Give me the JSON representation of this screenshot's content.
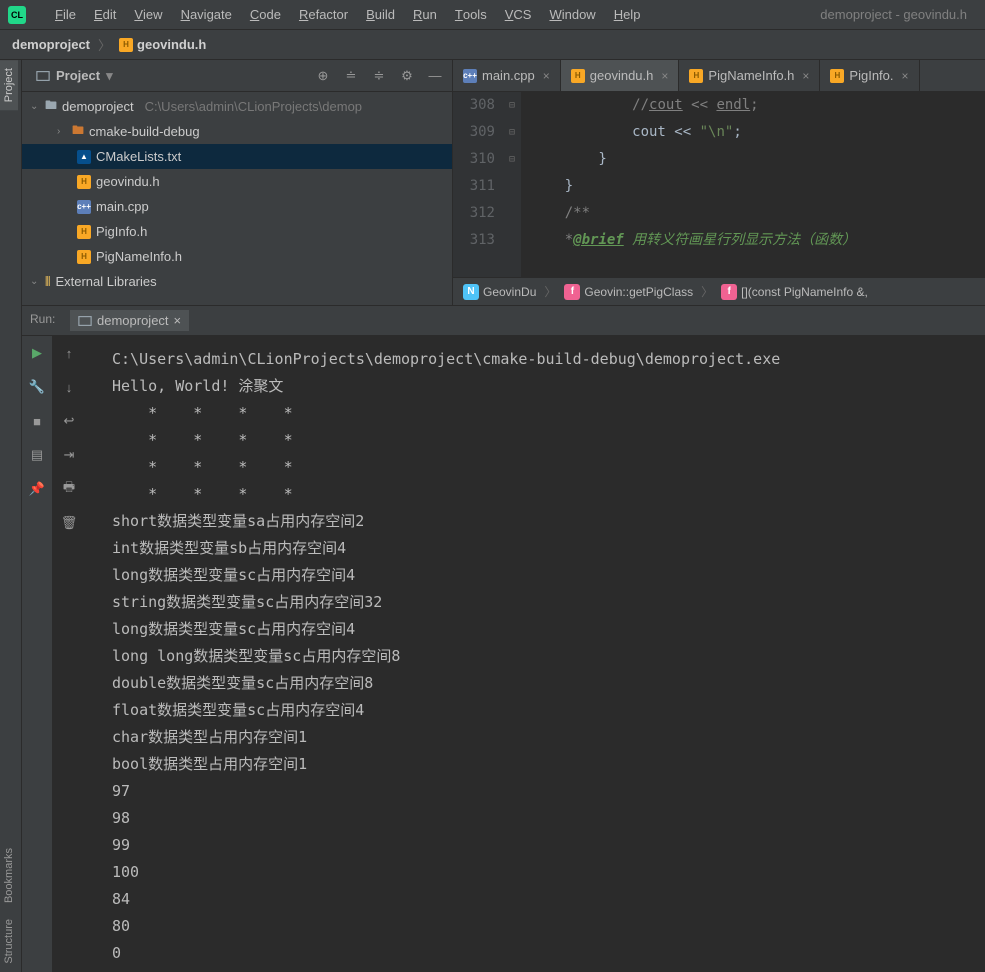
{
  "window_title": "demoproject - geovindu.h",
  "menu": [
    "File",
    "Edit",
    "View",
    "Navigate",
    "Code",
    "Refactor",
    "Build",
    "Run",
    "Tools",
    "VCS",
    "Window",
    "Help"
  ],
  "breadcrumbs": [
    {
      "label": "demoproject",
      "icon": "none"
    },
    {
      "label": "geovindu.h",
      "icon": "h"
    }
  ],
  "project_panel": {
    "title": "Project",
    "root": {
      "name": "demoproject",
      "path": "C:\\Users\\admin\\CLionProjects\\demop"
    },
    "children": [
      {
        "name": "cmake-build-debug",
        "icon": "folder-orange",
        "expandable": true
      },
      {
        "name": "CMakeLists.txt",
        "icon": "cmake"
      },
      {
        "name": "geovindu.h",
        "icon": "h"
      },
      {
        "name": "main.cpp",
        "icon": "cpp"
      },
      {
        "name": "PigInfo.h",
        "icon": "h"
      },
      {
        "name": "PigNameInfo.h",
        "icon": "h"
      }
    ],
    "external": "External Libraries"
  },
  "editor_tabs": [
    {
      "label": "main.cpp",
      "icon": "cpp",
      "active": false
    },
    {
      "label": "geovindu.h",
      "icon": "h",
      "active": true
    },
    {
      "label": "PigNameInfo.h",
      "icon": "h",
      "active": false
    },
    {
      "label": "PigInfo.",
      "icon": "h",
      "active": false
    }
  ],
  "code_lines": [
    {
      "n": 308,
      "t": "            //cout << endl;",
      "style": "comment-endl"
    },
    {
      "n": 309,
      "t": "            cout << \"\\n\";",
      "style": "code-str"
    },
    {
      "n": 310,
      "t": "        }",
      "style": "plain"
    },
    {
      "n": 311,
      "t": "    }",
      "style": "plain"
    },
    {
      "n": 312,
      "t": "    /**",
      "style": "comment"
    },
    {
      "n": 313,
      "t": "    *@brief 用转义符画星行列显示方法（函数）",
      "style": "doc"
    }
  ],
  "nav_trail": [
    {
      "badge": "N",
      "color": "badge-n",
      "label": "GeovinDu"
    },
    {
      "badge": "f",
      "color": "badge-f",
      "label": "Geovin::getPigClass"
    },
    {
      "badge": "f",
      "color": "badge-f",
      "label": "[](const PigNameInfo &,"
    }
  ],
  "run": {
    "label": "Run:",
    "tab": "demoproject",
    "output": [
      "C:\\Users\\admin\\CLionProjects\\demoproject\\cmake-build-debug\\demoproject.exe",
      "Hello, World! 涂聚文",
      "    *    *    *    *",
      "    *    *    *    *",
      "    *    *    *    *",
      "    *    *    *    *",
      "short数据类型变量sa占用内存空间2",
      "int数据类型变量sb占用内存空间4",
      "long数据类型变量sc占用内存空间4",
      "string数据类型变量sc占用内存空间32",
      "long数据类型变量sc占用内存空间4",
      "long long数据类型变量sc占用内存空间8",
      "double数据类型变量sc占用内存空间8",
      "float数据类型变量sc占用内存空间4",
      "char数据类型占用内存空间1",
      "bool数据类型占用内存空间1",
      "97",
      "98",
      "99",
      "100",
      "84",
      "80",
      "0"
    ]
  },
  "side_tabs": {
    "top": "Project",
    "bottom1": "Bookmarks",
    "bottom2": "Structure"
  }
}
